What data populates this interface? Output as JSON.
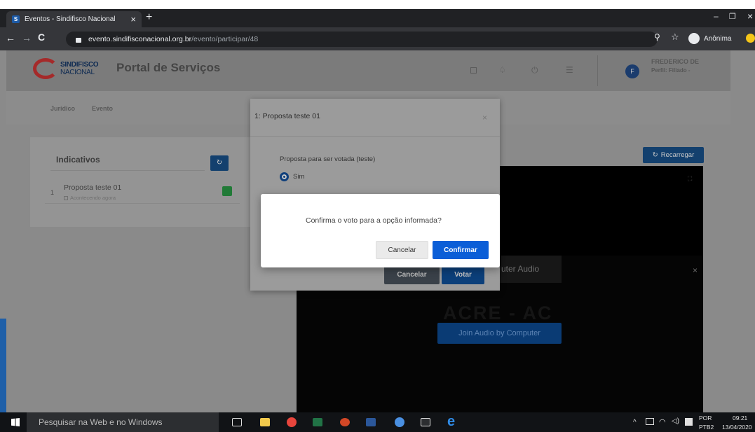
{
  "browser": {
    "tab_title": "Eventos - Sindifisco Nacional",
    "tab_close": "×",
    "new_tab": "+",
    "url_host": "evento.sindifisconacional.org.br",
    "url_path": "/evento/participar/48",
    "incognito_label": "Anônima",
    "window_minimize": "–",
    "window_restore": "❐",
    "window_close": "×"
  },
  "site": {
    "logo_line1": "SINDIFISCO",
    "logo_line2": "NACIONAL",
    "portal_title": "Portal de Serviços",
    "user_initial": "F",
    "user_name": "FREDERICO DE",
    "user_profile": "Perfil: Filiado -",
    "nav": [
      {
        "label": "Jurídico"
      },
      {
        "label": "Evento"
      }
    ],
    "indicativos": {
      "title": "Indicativos",
      "items": [
        {
          "num": "1",
          "title": "Proposta teste 01",
          "status": "Acontecendo agora"
        }
      ]
    },
    "recarregar_label": "Recarregar",
    "zoom": {
      "computer_audio_label": "uter Audio",
      "close": "×",
      "join_audio_label": "Join Audio by Computer",
      "watermark": "ACRE - AC"
    }
  },
  "proposta_modal": {
    "title": "1: Proposta teste 01",
    "close": "×",
    "question": "Proposta para ser votada (teste)",
    "option_sim": "Sim",
    "cancel_label": "Cancelar",
    "vote_label": "Votar"
  },
  "confirm_dialog": {
    "message": "Confirma o voto para a opção informada?",
    "cancel_label": "Cancelar",
    "confirm_label": "Confirmar"
  },
  "taskbar": {
    "search_placeholder": "Pesquisar na Web e no Windows",
    "lang_top": "POR",
    "lang_bottom": "PTB2",
    "time": "09:21",
    "date": "13/04/2020"
  },
  "colors": {
    "primary_blue": "#0b5ed7",
    "dark_blue": "#12407a",
    "chrome_dark": "#202124",
    "success_green": "#28a745"
  }
}
